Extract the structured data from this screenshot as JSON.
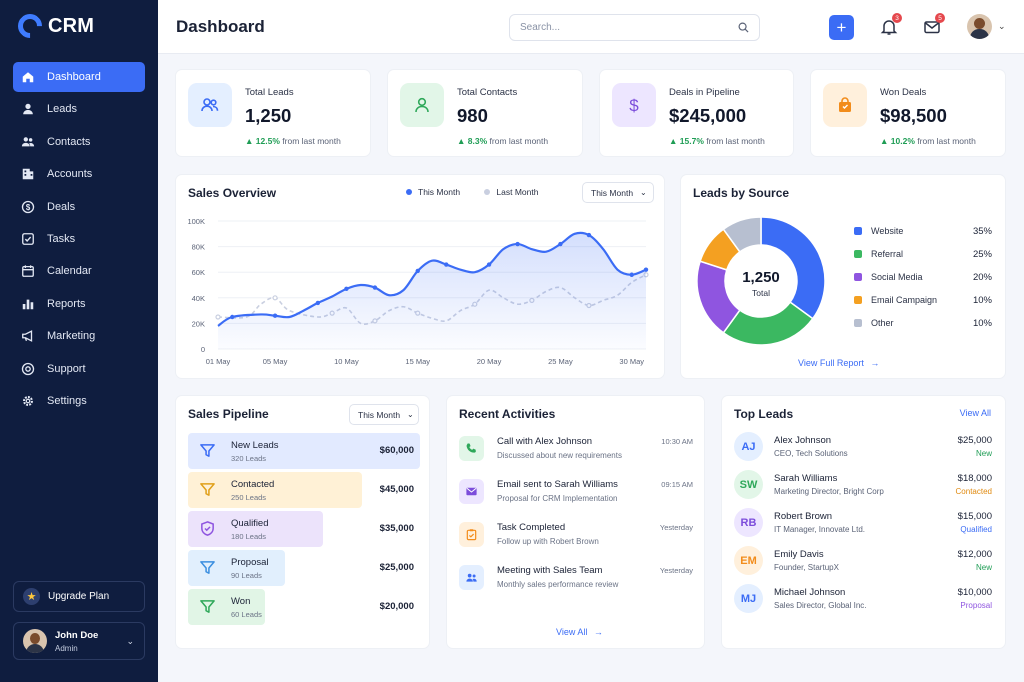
{
  "app": {
    "name": "CRM"
  },
  "colors": {
    "accent": "#3b6cf5",
    "sidebar": "#0f1d3f",
    "positive": "#1f9d55"
  },
  "sidebar": {
    "items": [
      {
        "label": "Dashboard",
        "icon": "home-icon",
        "active": true
      },
      {
        "label": "Leads",
        "icon": "user-icon"
      },
      {
        "label": "Contacts",
        "icon": "users-icon"
      },
      {
        "label": "Accounts",
        "icon": "building-icon"
      },
      {
        "label": "Deals",
        "icon": "dollar-circle-icon"
      },
      {
        "label": "Tasks",
        "icon": "checkbox-icon"
      },
      {
        "label": "Calendar",
        "icon": "calendar-icon"
      },
      {
        "label": "Reports",
        "icon": "bar-chart-icon"
      },
      {
        "label": "Marketing",
        "icon": "megaphone-icon"
      },
      {
        "label": "Support",
        "icon": "lifebuoy-icon"
      },
      {
        "label": "Settings",
        "icon": "gear-icon"
      }
    ],
    "upgrade_label": "Upgrade Plan",
    "user": {
      "name": "John Doe",
      "role": "Admin"
    }
  },
  "header": {
    "title": "Dashboard",
    "search_placeholder": "Search...",
    "notifications_count": "3",
    "messages_count": "5"
  },
  "stats": [
    {
      "label": "Total Leads",
      "value": "1,250",
      "delta": "12.5%",
      "delta_text": "from last month",
      "icon": "users-icon",
      "bg": "#e4efff",
      "fg": "#3b6cf5"
    },
    {
      "label": "Total Contacts",
      "value": "980",
      "delta": "8.3%",
      "delta_text": "from last month",
      "icon": "user-icon",
      "bg": "#e2f6e8",
      "fg": "#2fa85a"
    },
    {
      "label": "Deals in Pipeline",
      "value": "$245,000",
      "delta": "15.7%",
      "delta_text": "from last month",
      "icon": "dollar-icon",
      "bg": "#ede6ff",
      "fg": "#7c4ddb"
    },
    {
      "label": "Won Deals",
      "value": "$98,500",
      "delta": "10.2%",
      "delta_text": "from last month",
      "icon": "shopping-bag-icon",
      "bg": "#fff0dc",
      "fg": "#f28c1b"
    }
  ],
  "sales_overview": {
    "title": "Sales Overview",
    "legend_this": "This Month",
    "legend_last": "Last Month",
    "filter": "This Month"
  },
  "chart_data": {
    "type": "line",
    "title": "Sales Overview",
    "x_ticks": [
      "01 May",
      "05 May",
      "10 May",
      "15 May",
      "20 May",
      "25 May",
      "30 May"
    ],
    "y_ticks": [
      "0",
      "20K",
      "40K",
      "60K",
      "80K",
      "100K"
    ],
    "ylim": [
      0,
      100000
    ],
    "xlim": [
      1,
      31
    ],
    "grid": true,
    "legend": "top",
    "series": [
      {
        "name": "This Month",
        "color": "#3b6cf5",
        "x": [
          1,
          2,
          4,
          5,
          6,
          7,
          8,
          9,
          10,
          11,
          12,
          13,
          14,
          15,
          16,
          17,
          18,
          19,
          20,
          21,
          22,
          23,
          24,
          25,
          26,
          27,
          28,
          29,
          30,
          31
        ],
        "y": [
          18000,
          25000,
          27000,
          26000,
          25000,
          30000,
          36000,
          41000,
          47000,
          50000,
          48000,
          42000,
          46000,
          61000,
          69000,
          66000,
          62000,
          60000,
          66000,
          78000,
          82000,
          78000,
          76000,
          82000,
          90000,
          89000,
          78000,
          62000,
          58000,
          62000
        ]
      },
      {
        "name": "Last Month",
        "color": "#c9cfe0",
        "x": [
          1,
          3,
          4,
          5,
          6,
          8,
          9,
          10,
          11,
          12,
          13,
          14,
          15,
          16,
          17,
          18,
          19,
          20,
          21,
          22,
          23,
          24,
          25,
          26,
          27,
          28,
          29,
          30,
          31
        ],
        "y": [
          25000,
          25000,
          35000,
          40000,
          30000,
          25000,
          28000,
          32000,
          20000,
          22000,
          30000,
          33000,
          28000,
          24000,
          22000,
          30000,
          35000,
          46000,
          40000,
          35000,
          38000,
          45000,
          48000,
          40000,
          34000,
          38000,
          42000,
          52000,
          58000
        ]
      }
    ]
  },
  "leads_source": {
    "title": "Leads by Source",
    "center_value": "1,250",
    "center_label": "Total",
    "link": "View Full Report",
    "items": [
      {
        "label": "Website",
        "pct": "35%",
        "value": 35,
        "color": "#3b6cf5"
      },
      {
        "label": "Referral",
        "pct": "25%",
        "value": 25,
        "color": "#3bb861"
      },
      {
        "label": "Social Media",
        "pct": "20%",
        "value": 20,
        "color": "#8f55e0"
      },
      {
        "label": "Email Campaign",
        "pct": "10%",
        "value": 10,
        "color": "#f4a021"
      },
      {
        "label": "Other",
        "pct": "10%",
        "value": 10,
        "color": "#b7bfd0"
      }
    ]
  },
  "pipeline": {
    "title": "Sales Pipeline",
    "filter": "This Month",
    "stages": [
      {
        "name": "New Leads",
        "count": "320 Leads",
        "amount": "$60,000",
        "fill": 1.0,
        "bg": "#e2eaff",
        "fg": "#3b6cf5"
      },
      {
        "name": "Contacted",
        "count": "250 Leads",
        "amount": "$45,000",
        "fill": 0.75,
        "bg": "#fff1d6",
        "fg": "#e0a01a"
      },
      {
        "name": "Qualified",
        "count": "180 Leads",
        "amount": "$35,000",
        "fill": 0.58,
        "bg": "#ece3fb",
        "fg": "#8f55e0"
      },
      {
        "name": "Proposal",
        "count": "90 Leads",
        "amount": "$25,000",
        "fill": 0.42,
        "bg": "#e1effd",
        "fg": "#3b8fe0"
      },
      {
        "name": "Won",
        "count": "60 Leads",
        "amount": "$20,000",
        "fill": 0.33,
        "bg": "#e1f5e6",
        "fg": "#2fa85a"
      }
    ]
  },
  "activities": {
    "title": "Recent Activities",
    "link": "View All",
    "items": [
      {
        "title": "Call with Alex Johnson",
        "sub": "Discussed about new requirements",
        "time": "10:30 AM",
        "icon": "phone-icon",
        "bg": "#e2f6e8",
        "fg": "#2fa85a"
      },
      {
        "title": "Email sent to Sarah Williams",
        "sub": "Proposal for CRM Implementation",
        "time": "09:15 AM",
        "icon": "mail-icon",
        "bg": "#ede6ff",
        "fg": "#7c4ddb"
      },
      {
        "title": "Task Completed",
        "sub": "Follow up with Robert Brown",
        "time": "Yesterday",
        "icon": "clipboard-check-icon",
        "bg": "#fff0dc",
        "fg": "#f28c1b"
      },
      {
        "title": "Meeting with Sales Team",
        "sub": "Monthly sales performance review",
        "time": "Yesterday",
        "icon": "users-icon",
        "bg": "#e4efff",
        "fg": "#3b6cf5"
      }
    ]
  },
  "top_leads": {
    "title": "Top Leads",
    "link": "View All",
    "items": [
      {
        "initials": "AJ",
        "name": "Alex Johnson",
        "role": "CEO, Tech Solutions",
        "amount": "$25,000",
        "status": "New",
        "status_color": "#1f9d55",
        "bg": "#e4efff",
        "fg": "#3b6cf5"
      },
      {
        "initials": "SW",
        "name": "Sarah Williams",
        "role": "Marketing Director, Bright Corp",
        "amount": "$18,000",
        "status": "Contacted",
        "status_color": "#e08a10",
        "bg": "#e2f6e8",
        "fg": "#2fa85a"
      },
      {
        "initials": "RB",
        "name": "Robert Brown",
        "role": "IT Manager, Innovate Ltd.",
        "amount": "$15,000",
        "status": "Qualified",
        "status_color": "#3b6cf5",
        "bg": "#ede6ff",
        "fg": "#7c4ddb"
      },
      {
        "initials": "EM",
        "name": "Emily Davis",
        "role": "Founder, StartupX",
        "amount": "$12,000",
        "status": "New",
        "status_color": "#1f9d55",
        "bg": "#fff0dc",
        "fg": "#f28c1b"
      },
      {
        "initials": "MJ",
        "name": "Michael Johnson",
        "role": "Sales Director, Global Inc.",
        "amount": "$10,000",
        "status": "Proposal",
        "status_color": "#8f55e0",
        "bg": "#e4efff",
        "fg": "#3b6cf5"
      }
    ]
  }
}
